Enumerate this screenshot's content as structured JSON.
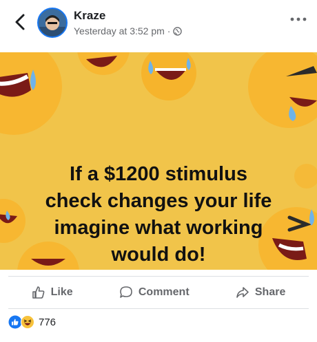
{
  "post": {
    "author": "Kraze",
    "timestamp": "Yesterday at 3:52 pm",
    "separator": "·",
    "privacy_icon": "globe-icon"
  },
  "image_text": [
    "If a $1200 stimulus",
    "check changes your life",
    "imagine what working",
    "would do!"
  ],
  "actions": {
    "like": "Like",
    "comment": "Comment",
    "share": "Share"
  },
  "reactions": {
    "icons": [
      "like-reaction-icon",
      "haha-reaction-icon"
    ],
    "count": "776"
  },
  "colors": {
    "image_bg": "#f1c44a",
    "accent": "#1877f2",
    "secondary_text": "#65676b"
  }
}
